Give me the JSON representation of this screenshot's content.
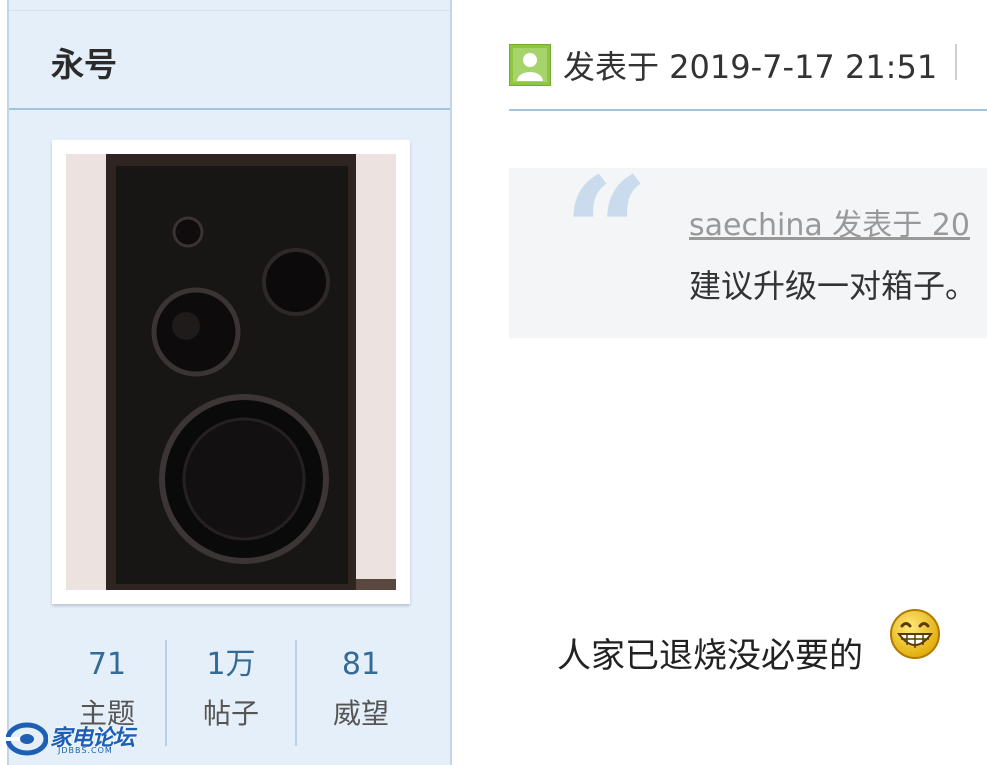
{
  "sidebar": {
    "username": "永号",
    "stats": [
      {
        "value": "71",
        "label": "主题"
      },
      {
        "value": "1万",
        "label": "帖子"
      },
      {
        "value": "81",
        "label": "威望"
      }
    ],
    "watermark": {
      "name": "家电论坛",
      "domain": "JDBBS.COM"
    }
  },
  "post": {
    "time": "发表于 2019-7-17 21:51",
    "quote": {
      "author_line": "saechina 发表于 20",
      "text": "建议升级一对箱子。"
    },
    "body": "人家已退烧没必要的",
    "emoji_icon": "grinning-face-icon"
  },
  "colors": {
    "sidebar_bg": "#e5eff9",
    "accent_blue": "#336a96",
    "rule_blue": "#a3c3da",
    "user_icon_green": "#8dc63f",
    "quote_bg": "#f3f5f7"
  }
}
